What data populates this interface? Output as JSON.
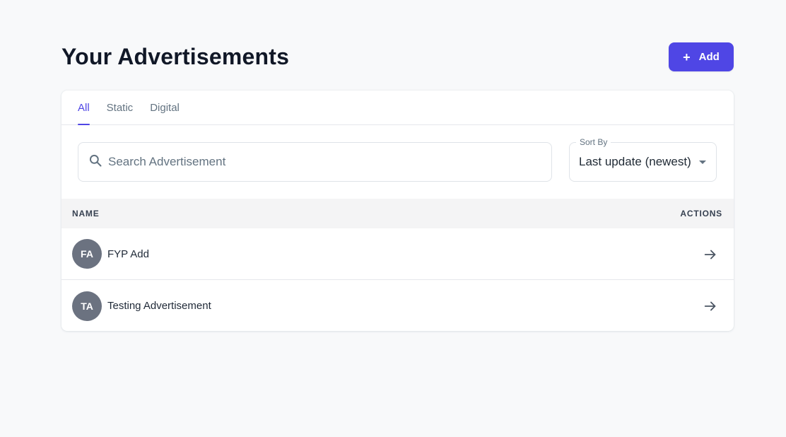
{
  "header": {
    "title": "Your Advertisements",
    "add_label": "Add",
    "add_icon": "+"
  },
  "tabs": [
    {
      "label": "All",
      "active": true
    },
    {
      "label": "Static",
      "active": false
    },
    {
      "label": "Digital",
      "active": false
    }
  ],
  "search": {
    "placeholder": "Search Advertisement",
    "value": ""
  },
  "sort": {
    "label": "Sort By",
    "value": "Last update (newest)"
  },
  "table": {
    "columns": [
      "NAME",
      "ACTIONS"
    ],
    "rows": [
      {
        "initials": "FA",
        "name": "FYP Add"
      },
      {
        "initials": "TA",
        "name": "Testing Advertisement"
      }
    ]
  },
  "colors": {
    "accent": "#4f46e5",
    "avatar": "#6b7280",
    "background": "#f8f9fa"
  },
  "icons": {
    "search": "search-icon",
    "sort_caret": "caret-down-icon",
    "row_action": "arrow-right-icon",
    "add": "plus-icon"
  }
}
